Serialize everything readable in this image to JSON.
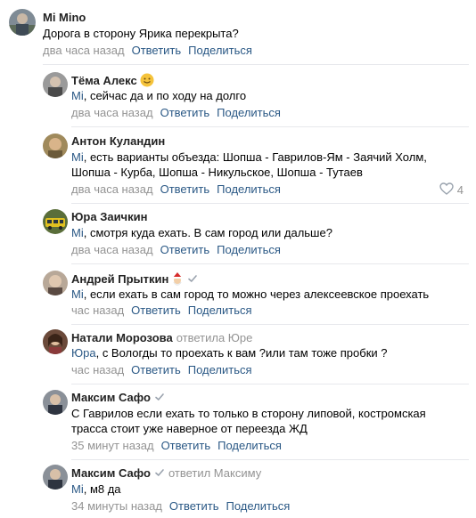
{
  "comments": [
    {
      "author": "Mi Mino",
      "text": "Дорога в сторону Ярика перекрыта?",
      "time": "два часа назад",
      "reply": "Ответить",
      "share": "Поделиться"
    },
    {
      "author": "Тёма Алекс",
      "addressee": "Mi",
      "text": ", сейчас да и по ходу на долго",
      "time": "два часа назад",
      "reply": "Ответить",
      "share": "Поделиться"
    },
    {
      "author": "Антон Куландин",
      "addressee": "Mi",
      "text_line1": ", есть варианты объезда: Шопша - Гаврилов-Ям - Заячий Холм,",
      "text_line2": "Шопша - Курба, Шопша - Никульское, Шопша - Тутаев",
      "time": "два часа назад",
      "reply": "Ответить",
      "share": "Поделиться",
      "likes": "4"
    },
    {
      "author": "Юра Заичкин",
      "addressee": "Mi",
      "text": ", смотря куда ехать. В сам город или дальше?",
      "time": "два часа назад",
      "reply": "Ответить",
      "share": "Поделиться"
    },
    {
      "author": "Андрей Прыткин",
      "addressee": "Mi",
      "text": ", если ехать в сам город то можно через алексеевское проехать",
      "time": "час назад",
      "reply": "Ответить",
      "share": "Поделиться"
    },
    {
      "author": "Натали Морозова",
      "reply_to": "ответила Юре",
      "addressee": "Юра",
      "text": ", с Вологды то проехать к вам ?или там тоже пробки ?",
      "time": "час назад",
      "reply": "Ответить",
      "share": "Поделиться"
    },
    {
      "author": "Максим Сафо",
      "text_line1": "С Гаврилов если ехать то только в сторону липовой, костромская",
      "text_line2": "трасса стоит уже наверное от переезда ЖД",
      "time": "35 минут назад",
      "reply": "Ответить",
      "share": "Поделиться"
    },
    {
      "author": "Максим Сафо",
      "reply_to": "ответил Максиму",
      "addressee": "Mi",
      "text": ", м8 да",
      "time": "34 минуты назад",
      "reply": "Ответить",
      "share": "Поделиться"
    }
  ],
  "colors": {
    "link": "#2a5885",
    "meta": "#939393",
    "divider": "#e7e8ec"
  }
}
